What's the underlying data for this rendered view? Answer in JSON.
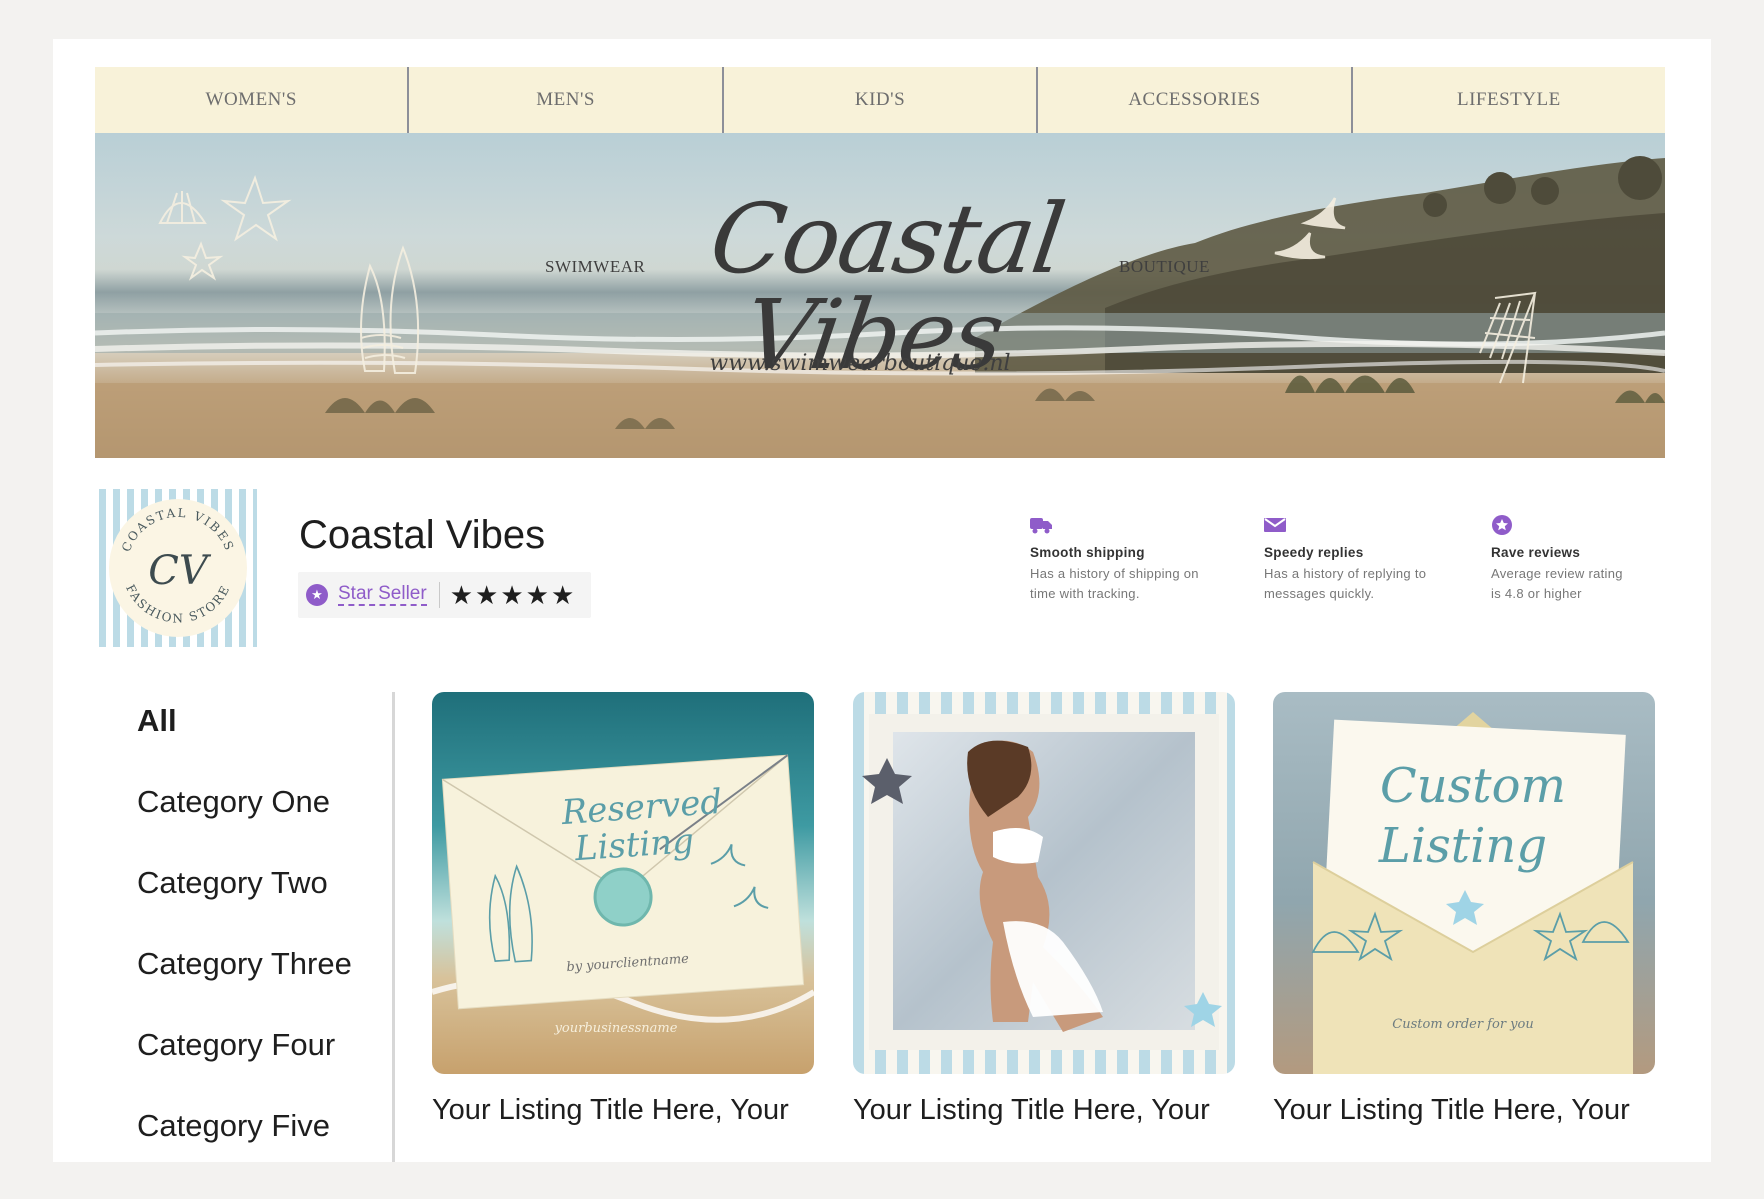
{
  "nav": {
    "items": [
      "WOMEN'S",
      "MEN'S",
      "KID'S",
      "ACCESSORIES",
      "LIFESTYLE"
    ]
  },
  "banner": {
    "left_text": "SWIMWEAR",
    "title": "Coastal Vibes",
    "right_text": "BOUTIQUE",
    "url": "www.swimwearboutique.nl",
    "icons": [
      "seashell-icon",
      "surfboard-icon",
      "seagull-icon",
      "beach-chair-icon"
    ]
  },
  "shop": {
    "logo": {
      "initials": "CV",
      "ring_top": "COASTAL VIBES",
      "ring_bottom": "FASHION STORE"
    },
    "name": "Coastal Vibes",
    "badge_label": "Star Seller",
    "rating_stars": 5,
    "stars_text": "★★★★★"
  },
  "features": [
    {
      "icon": "truck-icon",
      "title": "Smooth shipping",
      "line1": "Has a history of shipping on",
      "line2": "time with tracking."
    },
    {
      "icon": "envelope-icon",
      "title": "Speedy replies",
      "line1": "Has a history of replying to",
      "line2": "messages quickly."
    },
    {
      "icon": "star-badge-icon",
      "title": "Rave reviews",
      "line1": "Average review rating",
      "line2": "is 4.8 or higher"
    }
  ],
  "sidebar": {
    "items": [
      {
        "label": "All",
        "active": true
      },
      {
        "label": "Category One",
        "active": false
      },
      {
        "label": "Category Two",
        "active": false
      },
      {
        "label": "Category Three",
        "active": false
      },
      {
        "label": "Category Four",
        "active": false
      },
      {
        "label": "Category Five",
        "active": false
      }
    ]
  },
  "listings": [
    {
      "title": "Your Listing Title Here, Your",
      "image": {
        "script_line1": "Reserved",
        "script_line2": "Listing",
        "by_line": "by yourclientname",
        "footer": "yourbusinessname"
      }
    },
    {
      "title": "Your Listing Title Here, Your",
      "image": {}
    },
    {
      "title": "Your Listing Title Here, Your",
      "image": {
        "script_line1": "Custom",
        "script_line2": "Listing",
        "footer": "Custom order for you"
      }
    }
  ],
  "colors": {
    "nav_bg": "#f8f2d9",
    "star_seller_purple": "#8f5cc9",
    "stripe_blue": "#bcdbe6",
    "cream": "#fbf5e4",
    "teal_script": "#5b9ea8"
  }
}
